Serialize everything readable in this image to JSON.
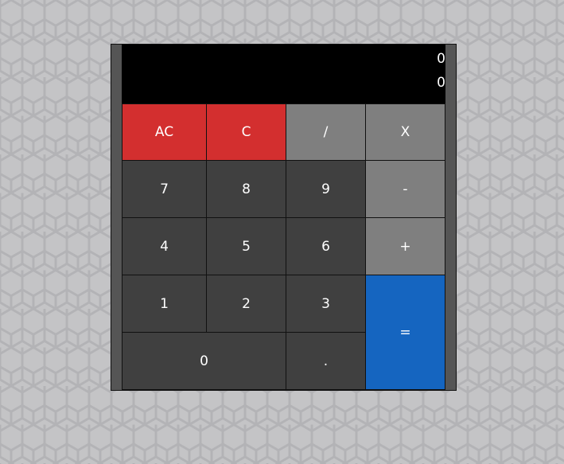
{
  "colors": {
    "background": "#c4c4c6",
    "frame": "#555555",
    "display": "#000000",
    "number_key": "#404040",
    "operator_key": "#7f7f7f",
    "clear_key": "#d32f2f",
    "equals_key": "#1565c0",
    "text": "#ffffff"
  },
  "display": {
    "previous": "0",
    "current": "0"
  },
  "keys": {
    "all_clear": "AC",
    "clear": "C",
    "divide": "/",
    "multiply": "X",
    "seven": "7",
    "eight": "8",
    "nine": "9",
    "minus": "-",
    "four": "4",
    "five": "5",
    "six": "6",
    "plus": "+",
    "one": "1",
    "two": "2",
    "three": "3",
    "equals": "=",
    "zero": "0",
    "decimal": "."
  }
}
